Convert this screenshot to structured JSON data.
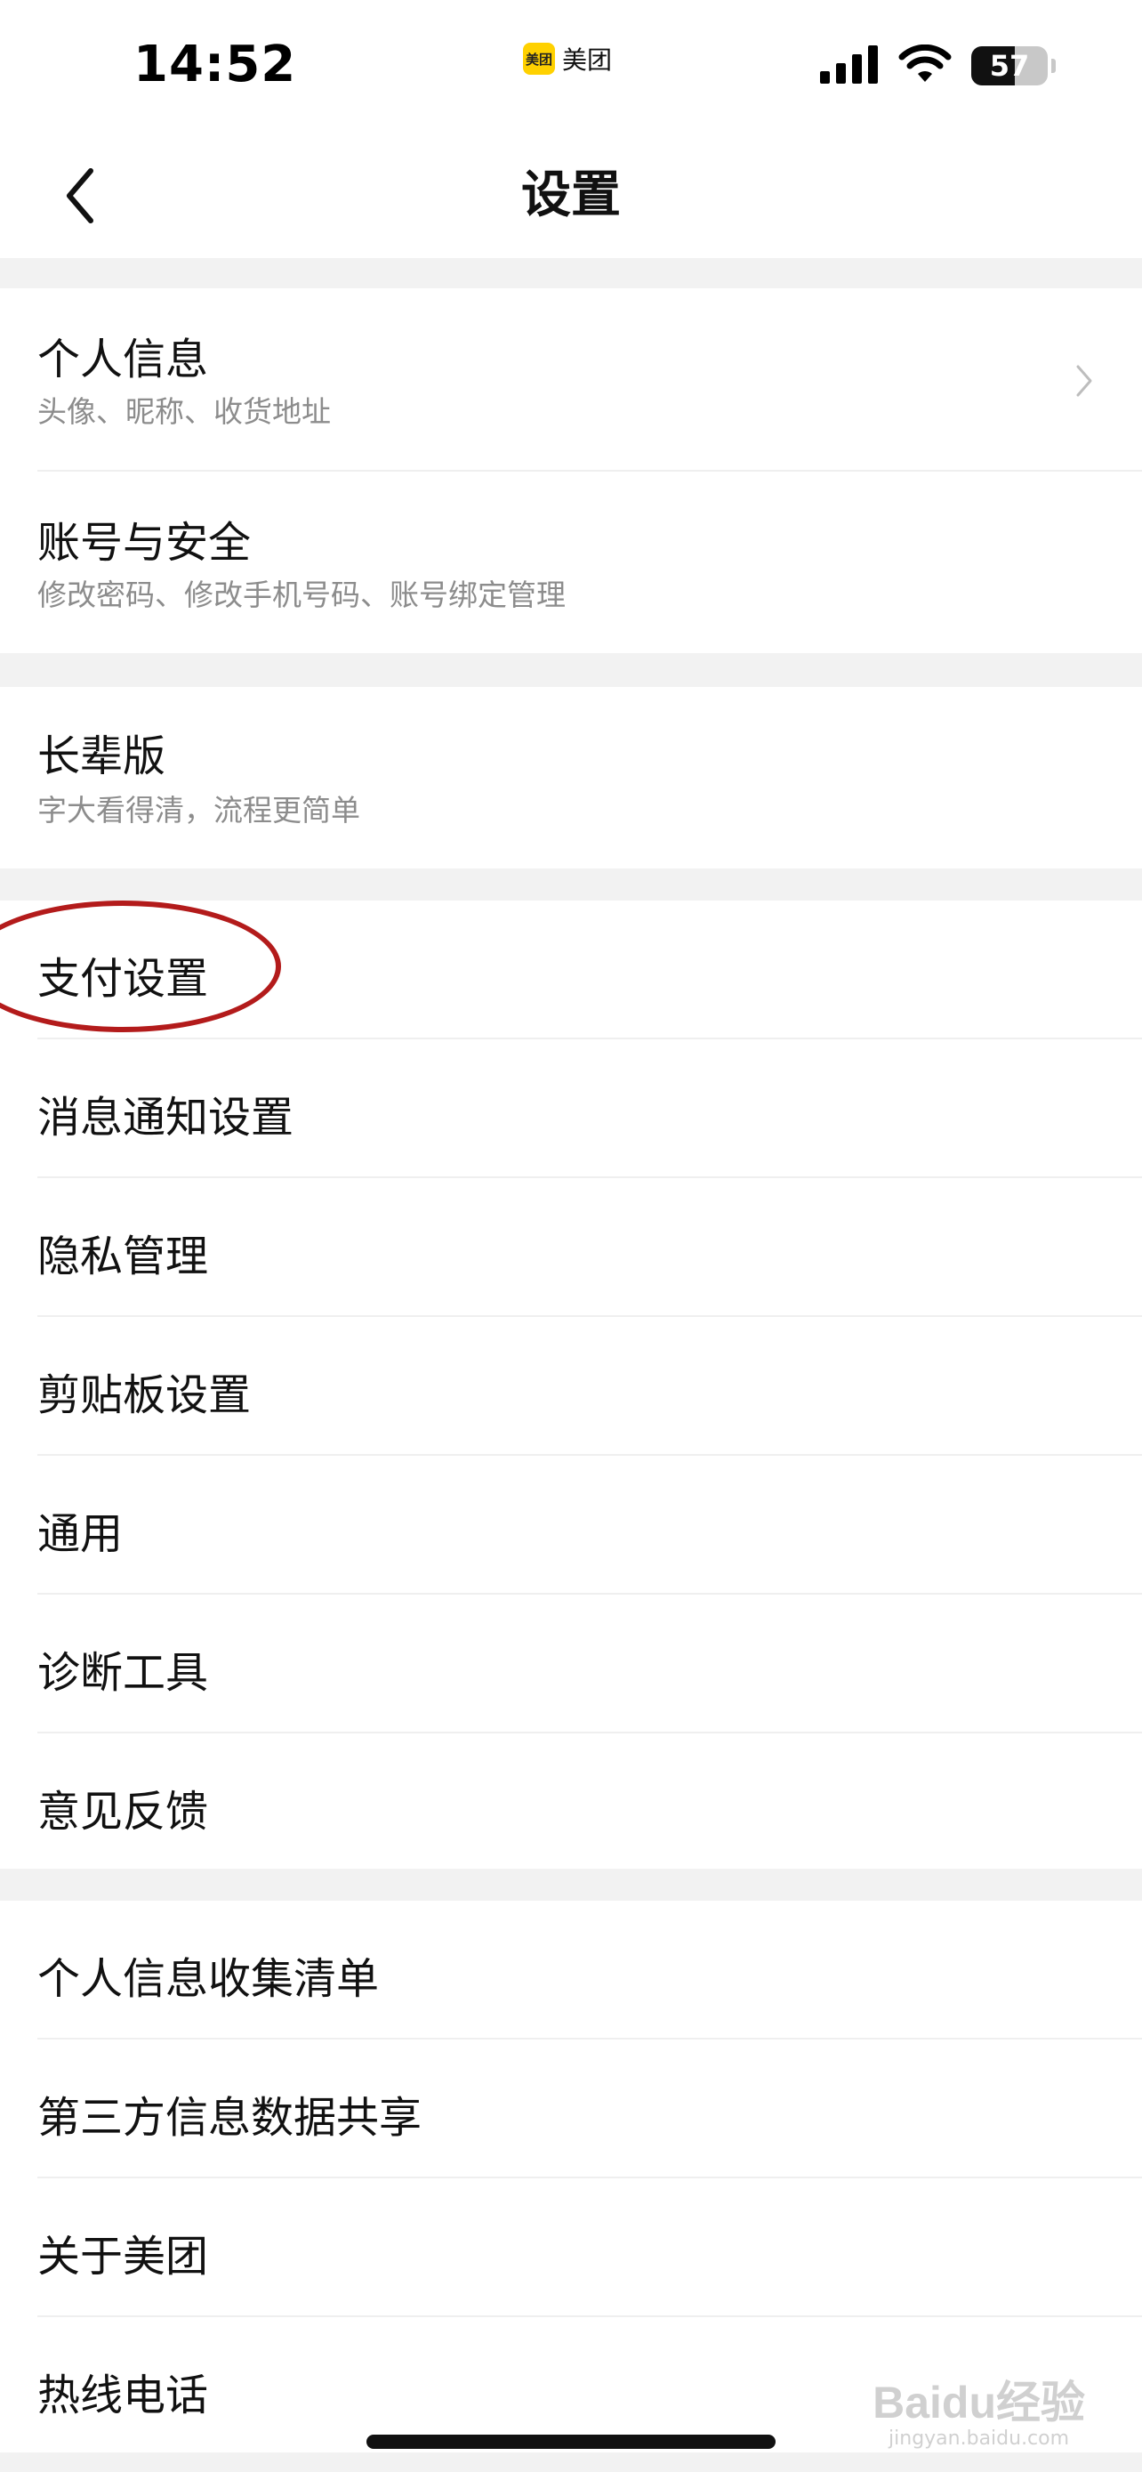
{
  "status_bar": {
    "time": "14:52",
    "app_logo_text": "美团",
    "app_name": "美团",
    "battery": "57",
    "icons": [
      "signal-icon",
      "wifi-icon",
      "battery-icon"
    ]
  },
  "nav": {
    "title": "设置",
    "back_icon": "chevron-left-icon"
  },
  "groups": [
    {
      "items": [
        {
          "title": "个人信息",
          "subtitle": "头像、昵称、收货地址"
        },
        {
          "title": "账号与安全",
          "subtitle": "修改密码、修改手机号码、账号绑定管理"
        }
      ]
    },
    {
      "items": [
        {
          "title": "长辈版",
          "subtitle": "字大看得清，流程更简单"
        }
      ]
    },
    {
      "items": [
        {
          "title": "支付设置"
        },
        {
          "title": "消息通知设置"
        },
        {
          "title": "隐私管理"
        },
        {
          "title": "剪贴板设置"
        },
        {
          "title": "通用"
        },
        {
          "title": "诊断工具"
        },
        {
          "title": "意见反馈"
        }
      ]
    },
    {
      "items": [
        {
          "title": "个人信息收集清单"
        },
        {
          "title": "第三方信息数据共享"
        },
        {
          "title": "关于美团"
        },
        {
          "title": "热线电话"
        }
      ]
    }
  ],
  "annotation": {
    "color": "#b31b1b",
    "target": "支付设置"
  },
  "watermark": {
    "main": "Baidu经验",
    "sub": "jingyan.baidu.com"
  },
  "colors": {
    "background": "#f2f2f2",
    "surface": "#ffffff",
    "text_primary": "#111111",
    "text_secondary": "#8c8c8c",
    "brand_yellow": "#ffd100"
  }
}
